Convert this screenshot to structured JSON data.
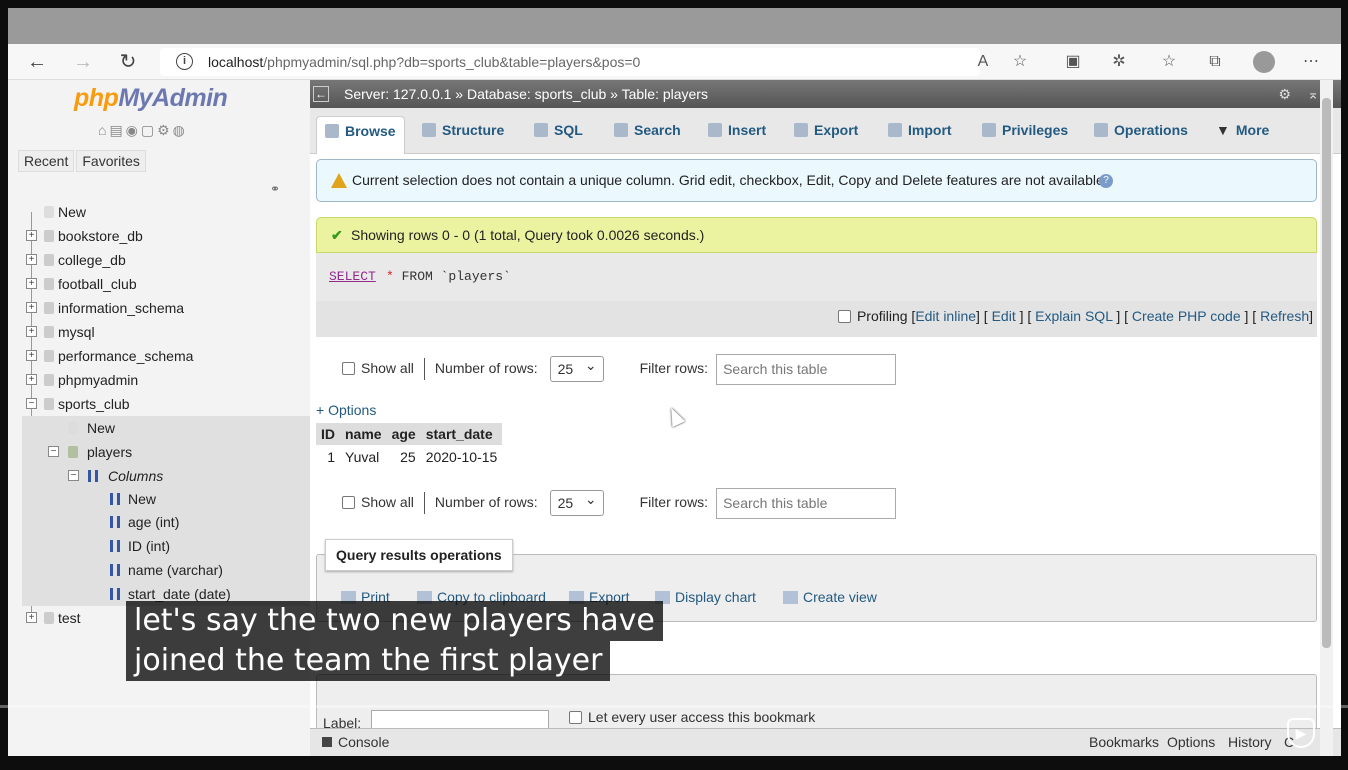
{
  "browser": {
    "url_host": "localhost",
    "url_path": "/phpmyadmin/sql.php?db=sports_club&table=players&pos=0"
  },
  "sidebar": {
    "logo_php": "php",
    "logo_myadmin": "MyAdmin",
    "recent": "Recent",
    "favorites": "Favorites",
    "tree": [
      {
        "label": "New"
      },
      {
        "label": "bookstore_db"
      },
      {
        "label": "college_db"
      },
      {
        "label": "football_club"
      },
      {
        "label": "information_schema"
      },
      {
        "label": "mysql"
      },
      {
        "label": "performance_schema"
      },
      {
        "label": "phpmyadmin"
      },
      {
        "label": "sports_club"
      },
      {
        "label": "New"
      },
      {
        "label": "players"
      },
      {
        "label": "Columns"
      },
      {
        "label": "New"
      },
      {
        "label": "age (int)"
      },
      {
        "label": "ID (int)"
      },
      {
        "label": "name (varchar)"
      },
      {
        "label": "start_date (date)"
      },
      {
        "label": "test"
      }
    ]
  },
  "breadcrumb": {
    "server": "Server: 127.0.0.1 »",
    "database": "Database: sports_club »",
    "table": "Table: players"
  },
  "tabs": [
    "Browse",
    "Structure",
    "SQL",
    "Search",
    "Insert",
    "Export",
    "Import",
    "Privileges",
    "Operations",
    "More"
  ],
  "notice": "Current selection does not contain a unique column. Grid edit, checkbox, Edit, Copy and Delete features are not available.",
  "success": "Showing rows 0 - 0 (1 total, Query took 0.0026 seconds.)",
  "sql": {
    "keyword": "SELECT",
    "star": "*",
    "rest": "FROM `players`"
  },
  "profiling": {
    "label": "Profiling",
    "edit_inline": "Edit inline",
    "edit": "Edit",
    "explain": "Explain SQL",
    "create_php": "Create PHP code",
    "refresh": "Refresh"
  },
  "controls": {
    "show_all": "Show all",
    "number_of_rows": "Number of rows:",
    "rows_value": "25",
    "filter_rows": "Filter rows:",
    "filter_placeholder": "Search this table"
  },
  "options_link": "+ Options",
  "results": {
    "columns": [
      "ID",
      "name",
      "age",
      "start_date"
    ],
    "rows": [
      [
        "1",
        "Yuval",
        "25",
        "2020-10-15"
      ]
    ]
  },
  "query_ops": {
    "legend": "Query results operations",
    "items": [
      "Print",
      "Copy to clipboard",
      "Export",
      "Display chart",
      "Create view"
    ]
  },
  "bookmark": {
    "label": "Label:",
    "checkbox": "Let every user access this bookmark"
  },
  "console": {
    "label": "Console",
    "links": [
      "Bookmarks",
      "Options",
      "History",
      "C"
    ]
  },
  "caption": {
    "line1": "let's say the two new players have",
    "line2": "joined the team the first player"
  }
}
